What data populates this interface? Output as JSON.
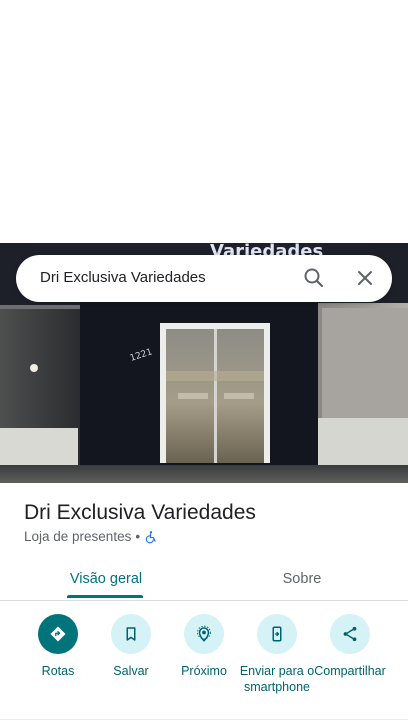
{
  "search": {
    "query": "Dri Exclusiva Variedades"
  },
  "photo": {
    "sign_text": "Variedades",
    "door_number": "1221"
  },
  "place": {
    "name": "Dri Exclusiva Variedades",
    "category": "Loja de presentes",
    "separator": "•",
    "accessibility_icon": "wheelchair-icon"
  },
  "tabs": [
    {
      "label": "Visão geral",
      "active": true
    },
    {
      "label": "Sobre",
      "active": false
    }
  ],
  "actions": [
    {
      "label": "Rotas",
      "icon": "directions-icon"
    },
    {
      "label": "Salvar",
      "icon": "bookmark-icon"
    },
    {
      "label": "Próximo",
      "icon": "nearby-icon"
    },
    {
      "label": "Enviar para o smartphone",
      "icon": "send-to-phone-icon"
    },
    {
      "label": "Compartilhar",
      "icon": "share-icon"
    }
  ],
  "colors": {
    "accent": "#01747a",
    "action_bg": "#d5f2f6",
    "primary_action": "#01737b",
    "accessibility_blue": "#1a73e8"
  }
}
